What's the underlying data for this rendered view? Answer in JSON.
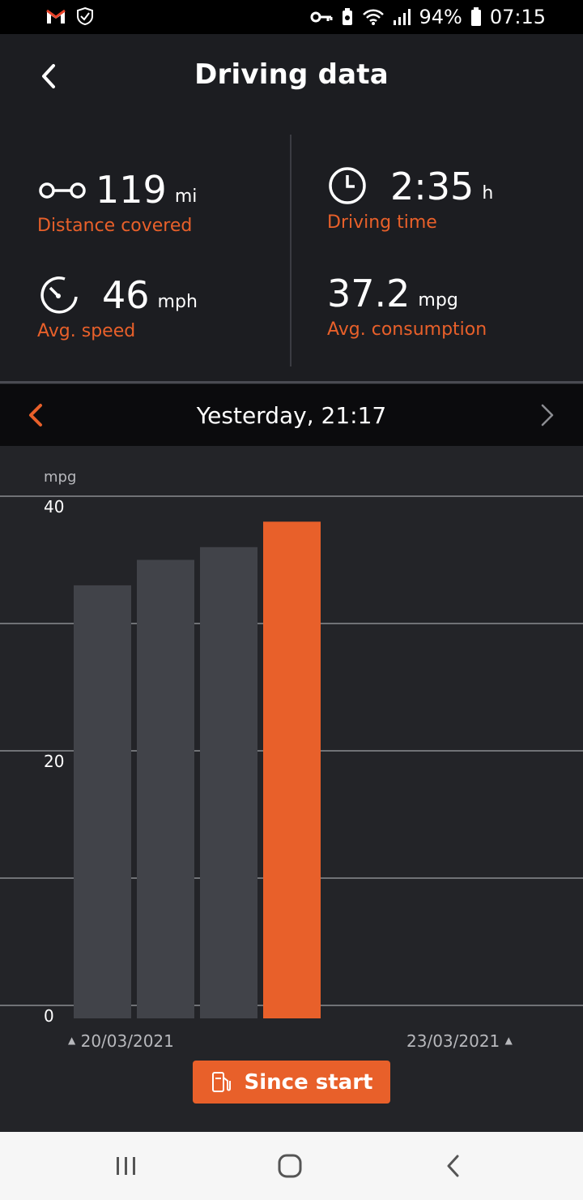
{
  "status_bar": {
    "battery_percent": "94%",
    "time": "07:15",
    "icons": [
      "gmail-icon",
      "shield-icon",
      "key-icon",
      "battery-saver-icon",
      "wifi-icon",
      "signal-icon",
      "battery-icon"
    ]
  },
  "header": {
    "title": "Driving data"
  },
  "stats": {
    "distance": {
      "value": "119",
      "unit": "mi",
      "label": "Distance covered"
    },
    "time": {
      "value": "2:35",
      "unit": "h",
      "label": "Driving time"
    },
    "speed": {
      "value": "46",
      "unit": "mph",
      "label": "Avg. speed"
    },
    "consumption": {
      "value": "37.2",
      "unit": "mpg",
      "label": "Avg. consumption"
    }
  },
  "date_nav": {
    "label": "Yesterday, 21:17"
  },
  "chart_data": {
    "type": "bar",
    "ylabel": "mpg",
    "ylim": [
      0,
      40
    ],
    "yticks": [
      "40",
      "20",
      "0"
    ],
    "values": [
      33,
      35,
      36,
      38
    ],
    "selected_index": 3,
    "grid": true,
    "x_start_label": "20/03/2021",
    "x_end_label": "23/03/2021"
  },
  "since_button": {
    "label": "Since start"
  },
  "colors": {
    "accent": "#e8602a",
    "bar": "#414349",
    "background": "#232428"
  }
}
